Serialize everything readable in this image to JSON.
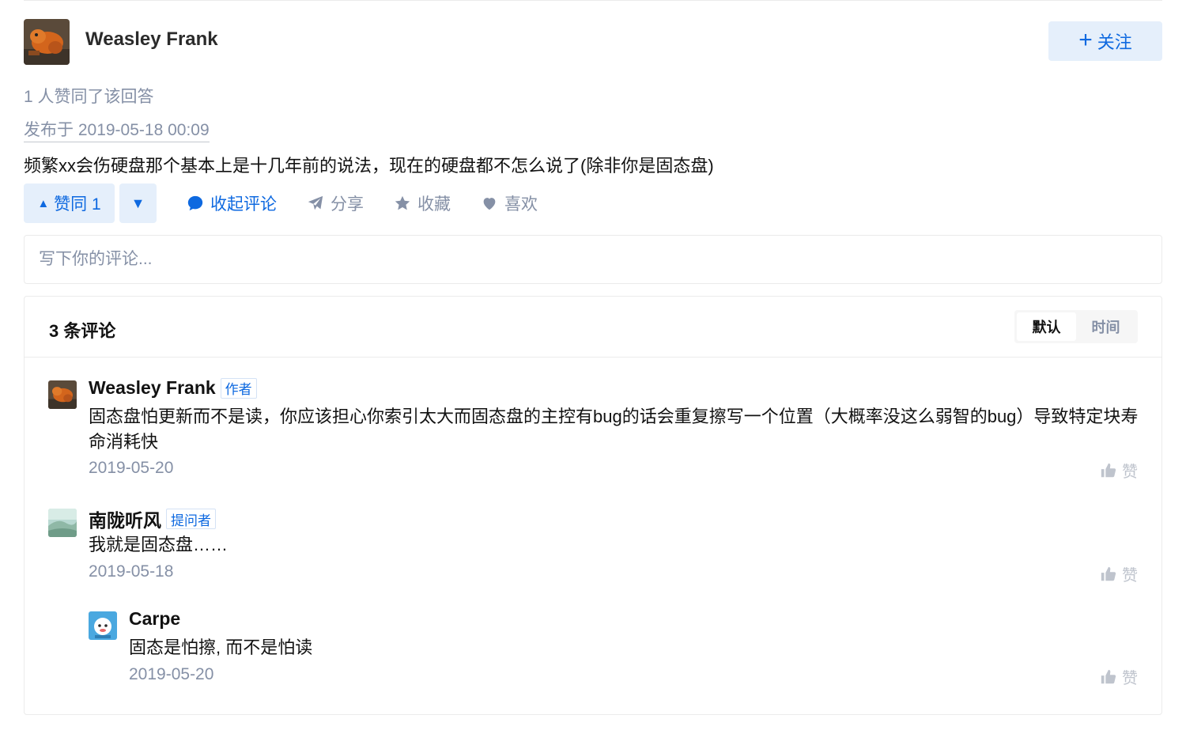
{
  "author": {
    "name": "Weasley Frank",
    "follow_label": "关注"
  },
  "answer": {
    "votes_text": "1 人赞同了该回答",
    "published": "发布于 2019-05-18 00:09",
    "content": "频繁xx会伤硬盘那个基本上是十几年前的说法，现在的硬盘都不怎么说了(除非你是固态盘)"
  },
  "actions": {
    "upvote_label": "赞同 1",
    "collapse_comments": "收起评论",
    "share": "分享",
    "favorite": "收藏",
    "like": "喜欢"
  },
  "comment_input": {
    "placeholder": "写下你的评论..."
  },
  "comments_panel": {
    "title": "3 条评论",
    "sort_default": "默认",
    "sort_time": "时间",
    "items": [
      {
        "name": "Weasley Frank",
        "tag": "作者",
        "text": "固态盘怕更新而不是读，你应该担心你索引太大而固态盘的主控有bug的话会重复擦写一个位置（大概率没这么弱智的bug）导致特定块寿命消耗快",
        "date": "2019-05-20",
        "like_label": "赞"
      },
      {
        "name": "南陇听风",
        "tag": "提问者",
        "text": "我就是固态盘……",
        "date": "2019-05-18",
        "like_label": "赞"
      },
      {
        "name": "Carpe",
        "tag": "",
        "text": "固态是怕擦, 而不是怕读",
        "date": "2019-05-20",
        "like_label": "赞"
      }
    ]
  },
  "colors": {
    "brand_blue": "#0e69e0",
    "light_blue_bg": "#e5effb",
    "muted_gray": "#8590a6",
    "border": "#ebebeb"
  },
  "icons": [
    "plus-icon",
    "triangle-up-icon",
    "triangle-down-icon",
    "comment-bubble-icon",
    "paper-plane-icon",
    "star-icon",
    "heart-icon",
    "thumbs-up-icon"
  ]
}
